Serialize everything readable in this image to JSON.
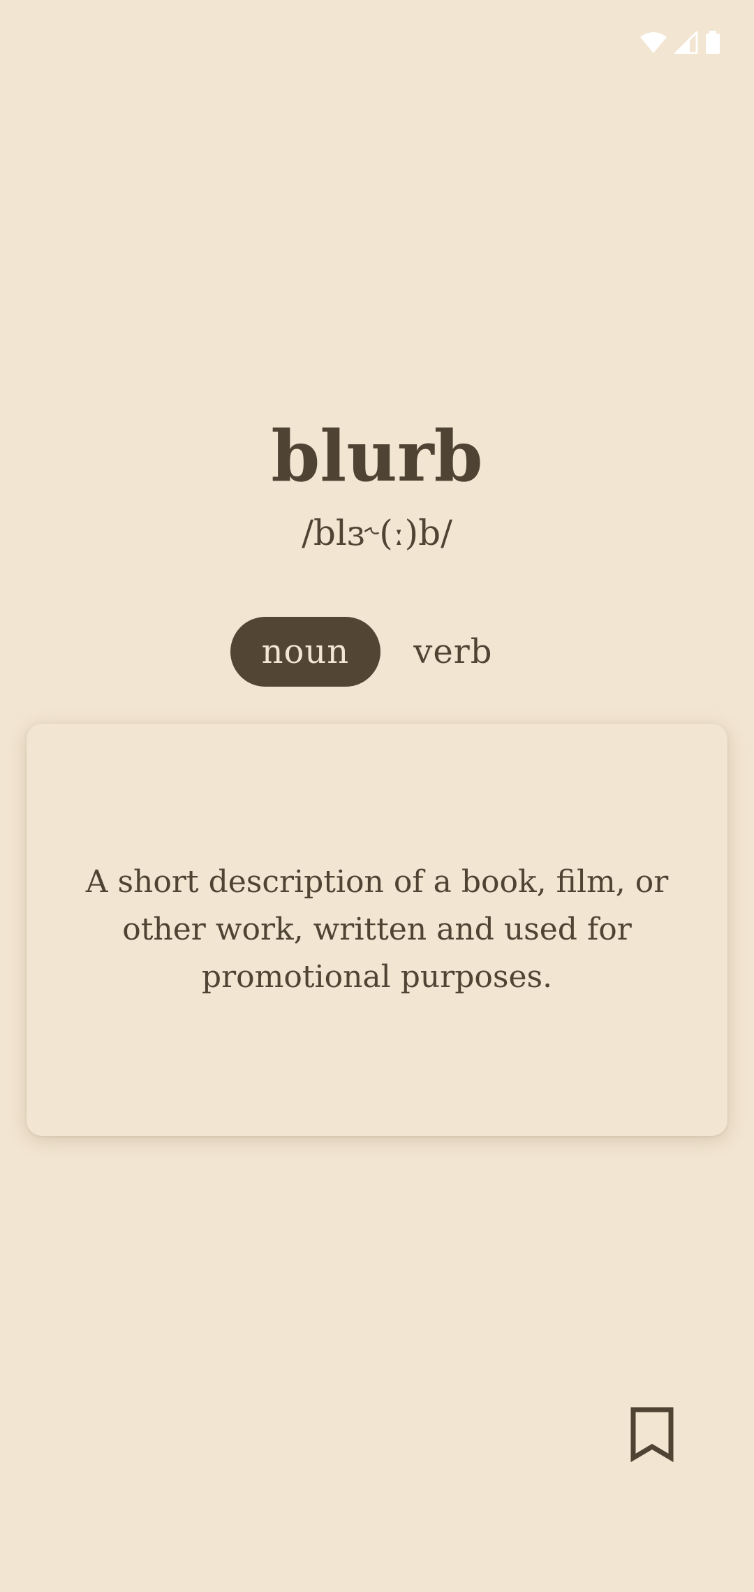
{
  "status_bar": {
    "icons": [
      "wifi-icon",
      "cell-signal-icon",
      "battery-icon"
    ]
  },
  "entry": {
    "word": "blurb",
    "phonetic": "/blɜ˞(ː)b/",
    "parts_of_speech": [
      {
        "label": "noun",
        "selected": true
      },
      {
        "label": "verb",
        "selected": false
      }
    ],
    "definition": "A short description of a book, film, or other work, written and used for promotional purposes."
  },
  "actions": {
    "bookmark_icon": "bookmark-icon"
  },
  "colors": {
    "background": "#f2e5d1",
    "text": "#4f4434",
    "chip_active_bg": "#524533",
    "chip_active_text": "#f2e5d1",
    "status_icons": "#ffffff"
  }
}
